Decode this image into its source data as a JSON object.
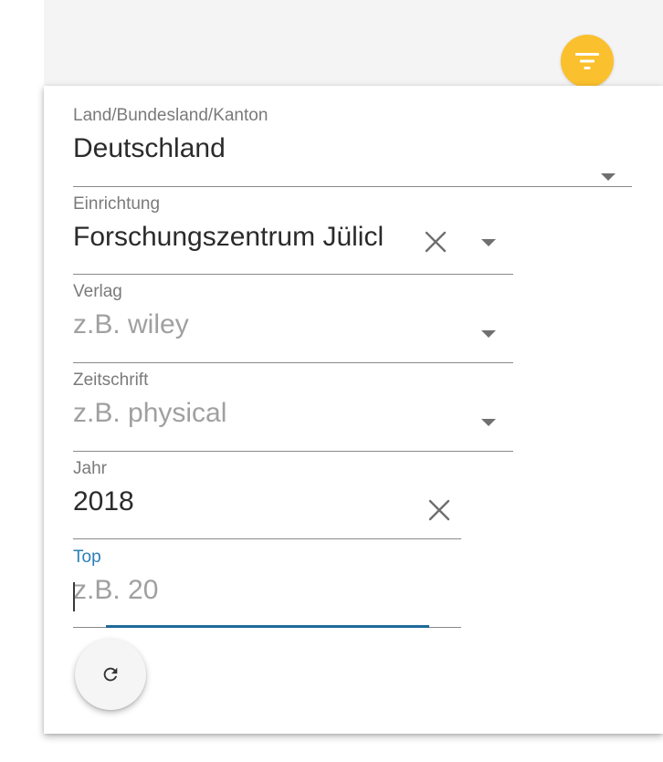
{
  "filters": {
    "country": {
      "label": "Land/Bundesland/Kanton",
      "value": "Deutschland"
    },
    "institution": {
      "label": "Einrichtung",
      "value": "Forschungszentrum Jülicl"
    },
    "publisher": {
      "label": "Verlag",
      "placeholder": "z.B. wiley"
    },
    "journal": {
      "label": "Zeitschrift",
      "placeholder": "z.B. physical"
    },
    "year": {
      "label": "Jahr",
      "value": "2018"
    },
    "top": {
      "label": "Top",
      "placeholder": "z.B. 20"
    }
  },
  "icons": {
    "filter": "filter-icon",
    "refresh": "refresh-icon",
    "clear": "close-icon",
    "dropdown": "dropdown-arrow-icon"
  },
  "colors": {
    "accent": "#fbc02d",
    "focus": "#1e6a9a",
    "active_label": "#2a7fb8"
  }
}
